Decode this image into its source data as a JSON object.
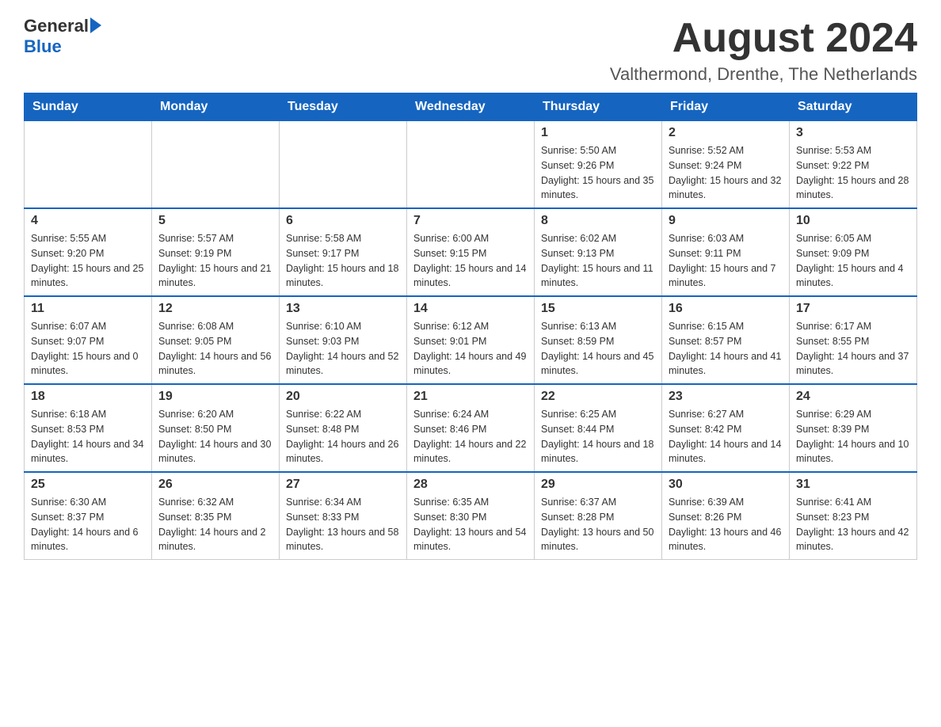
{
  "logo": {
    "general": "General",
    "blue": "Blue",
    "arrow_color": "#1565C0"
  },
  "header": {
    "month_title": "August 2024",
    "location": "Valthermond, Drenthe, The Netherlands"
  },
  "days_of_week": [
    "Sunday",
    "Monday",
    "Tuesday",
    "Wednesday",
    "Thursday",
    "Friday",
    "Saturday"
  ],
  "weeks": [
    {
      "days": [
        {
          "number": "",
          "info": ""
        },
        {
          "number": "",
          "info": ""
        },
        {
          "number": "",
          "info": ""
        },
        {
          "number": "",
          "info": ""
        },
        {
          "number": "1",
          "info": "Sunrise: 5:50 AM\nSunset: 9:26 PM\nDaylight: 15 hours and 35 minutes."
        },
        {
          "number": "2",
          "info": "Sunrise: 5:52 AM\nSunset: 9:24 PM\nDaylight: 15 hours and 32 minutes."
        },
        {
          "number": "3",
          "info": "Sunrise: 5:53 AM\nSunset: 9:22 PM\nDaylight: 15 hours and 28 minutes."
        }
      ]
    },
    {
      "days": [
        {
          "number": "4",
          "info": "Sunrise: 5:55 AM\nSunset: 9:20 PM\nDaylight: 15 hours and 25 minutes."
        },
        {
          "number": "5",
          "info": "Sunrise: 5:57 AM\nSunset: 9:19 PM\nDaylight: 15 hours and 21 minutes."
        },
        {
          "number": "6",
          "info": "Sunrise: 5:58 AM\nSunset: 9:17 PM\nDaylight: 15 hours and 18 minutes."
        },
        {
          "number": "7",
          "info": "Sunrise: 6:00 AM\nSunset: 9:15 PM\nDaylight: 15 hours and 14 minutes."
        },
        {
          "number": "8",
          "info": "Sunrise: 6:02 AM\nSunset: 9:13 PM\nDaylight: 15 hours and 11 minutes."
        },
        {
          "number": "9",
          "info": "Sunrise: 6:03 AM\nSunset: 9:11 PM\nDaylight: 15 hours and 7 minutes."
        },
        {
          "number": "10",
          "info": "Sunrise: 6:05 AM\nSunset: 9:09 PM\nDaylight: 15 hours and 4 minutes."
        }
      ]
    },
    {
      "days": [
        {
          "number": "11",
          "info": "Sunrise: 6:07 AM\nSunset: 9:07 PM\nDaylight: 15 hours and 0 minutes."
        },
        {
          "number": "12",
          "info": "Sunrise: 6:08 AM\nSunset: 9:05 PM\nDaylight: 14 hours and 56 minutes."
        },
        {
          "number": "13",
          "info": "Sunrise: 6:10 AM\nSunset: 9:03 PM\nDaylight: 14 hours and 52 minutes."
        },
        {
          "number": "14",
          "info": "Sunrise: 6:12 AM\nSunset: 9:01 PM\nDaylight: 14 hours and 49 minutes."
        },
        {
          "number": "15",
          "info": "Sunrise: 6:13 AM\nSunset: 8:59 PM\nDaylight: 14 hours and 45 minutes."
        },
        {
          "number": "16",
          "info": "Sunrise: 6:15 AM\nSunset: 8:57 PM\nDaylight: 14 hours and 41 minutes."
        },
        {
          "number": "17",
          "info": "Sunrise: 6:17 AM\nSunset: 8:55 PM\nDaylight: 14 hours and 37 minutes."
        }
      ]
    },
    {
      "days": [
        {
          "number": "18",
          "info": "Sunrise: 6:18 AM\nSunset: 8:53 PM\nDaylight: 14 hours and 34 minutes."
        },
        {
          "number": "19",
          "info": "Sunrise: 6:20 AM\nSunset: 8:50 PM\nDaylight: 14 hours and 30 minutes."
        },
        {
          "number": "20",
          "info": "Sunrise: 6:22 AM\nSunset: 8:48 PM\nDaylight: 14 hours and 26 minutes."
        },
        {
          "number": "21",
          "info": "Sunrise: 6:24 AM\nSunset: 8:46 PM\nDaylight: 14 hours and 22 minutes."
        },
        {
          "number": "22",
          "info": "Sunrise: 6:25 AM\nSunset: 8:44 PM\nDaylight: 14 hours and 18 minutes."
        },
        {
          "number": "23",
          "info": "Sunrise: 6:27 AM\nSunset: 8:42 PM\nDaylight: 14 hours and 14 minutes."
        },
        {
          "number": "24",
          "info": "Sunrise: 6:29 AM\nSunset: 8:39 PM\nDaylight: 14 hours and 10 minutes."
        }
      ]
    },
    {
      "days": [
        {
          "number": "25",
          "info": "Sunrise: 6:30 AM\nSunset: 8:37 PM\nDaylight: 14 hours and 6 minutes."
        },
        {
          "number": "26",
          "info": "Sunrise: 6:32 AM\nSunset: 8:35 PM\nDaylight: 14 hours and 2 minutes."
        },
        {
          "number": "27",
          "info": "Sunrise: 6:34 AM\nSunset: 8:33 PM\nDaylight: 13 hours and 58 minutes."
        },
        {
          "number": "28",
          "info": "Sunrise: 6:35 AM\nSunset: 8:30 PM\nDaylight: 13 hours and 54 minutes."
        },
        {
          "number": "29",
          "info": "Sunrise: 6:37 AM\nSunset: 8:28 PM\nDaylight: 13 hours and 50 minutes."
        },
        {
          "number": "30",
          "info": "Sunrise: 6:39 AM\nSunset: 8:26 PM\nDaylight: 13 hours and 46 minutes."
        },
        {
          "number": "31",
          "info": "Sunrise: 6:41 AM\nSunset: 8:23 PM\nDaylight: 13 hours and 42 minutes."
        }
      ]
    }
  ]
}
